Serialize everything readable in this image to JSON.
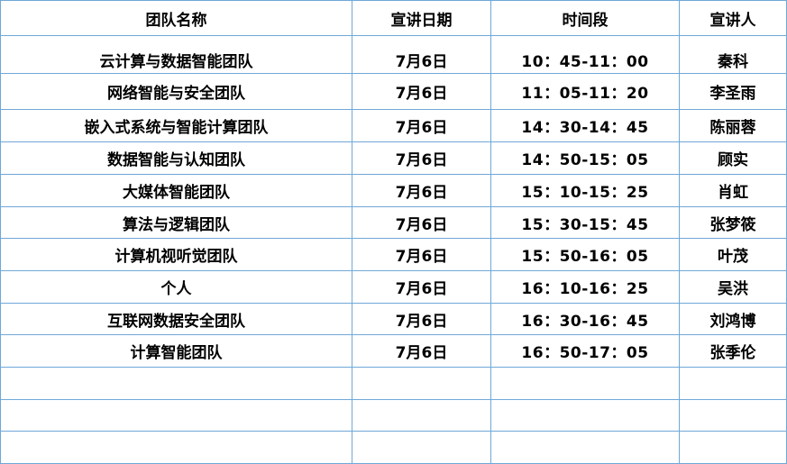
{
  "headers": [
    "团队名称",
    "宣讲日期",
    "时间段",
    "宣讲人"
  ],
  "rows": [
    {
      "team": "云计算与数据智能团队",
      "date": "7月6日",
      "time": "10：45-11：00",
      "speaker": "秦科"
    },
    {
      "team": "网络智能与安全团队",
      "date": "7月6日",
      "time": "11：05-11：20",
      "speaker": "李圣雨"
    },
    {
      "team": "嵌入式系统与智能计算团队",
      "date": "7月6日",
      "time": "14：30-14：45",
      "speaker": "陈丽蓉"
    },
    {
      "team": "数据智能与认知团队",
      "date": "7月6日",
      "time": "14：50-15：05",
      "speaker": "顾实"
    },
    {
      "team": "大媒体智能团队",
      "date": "7月6日",
      "time": "15：10-15：25",
      "speaker": "肖虹"
    },
    {
      "team": "算法与逻辑团队",
      "date": "7月6日",
      "time": "15：30-15：45",
      "speaker": "张梦筱"
    },
    {
      "team": "计算机视听觉团队",
      "date": "7月6日",
      "time": "15：50-16：05",
      "speaker": "叶茂"
    },
    {
      "team": "个人",
      "date": "7月6日",
      "time": "16：10-16：25",
      "speaker": "吴洪"
    },
    {
      "team": "互联网数据安全团队",
      "date": "7月6日",
      "time": "16：30-16：45",
      "speaker": "刘鸿博"
    },
    {
      "team": "计算智能团队",
      "date": "7月6日",
      "time": "16：50-17：05",
      "speaker": "张季伦"
    }
  ],
  "empty_rows": 3
}
